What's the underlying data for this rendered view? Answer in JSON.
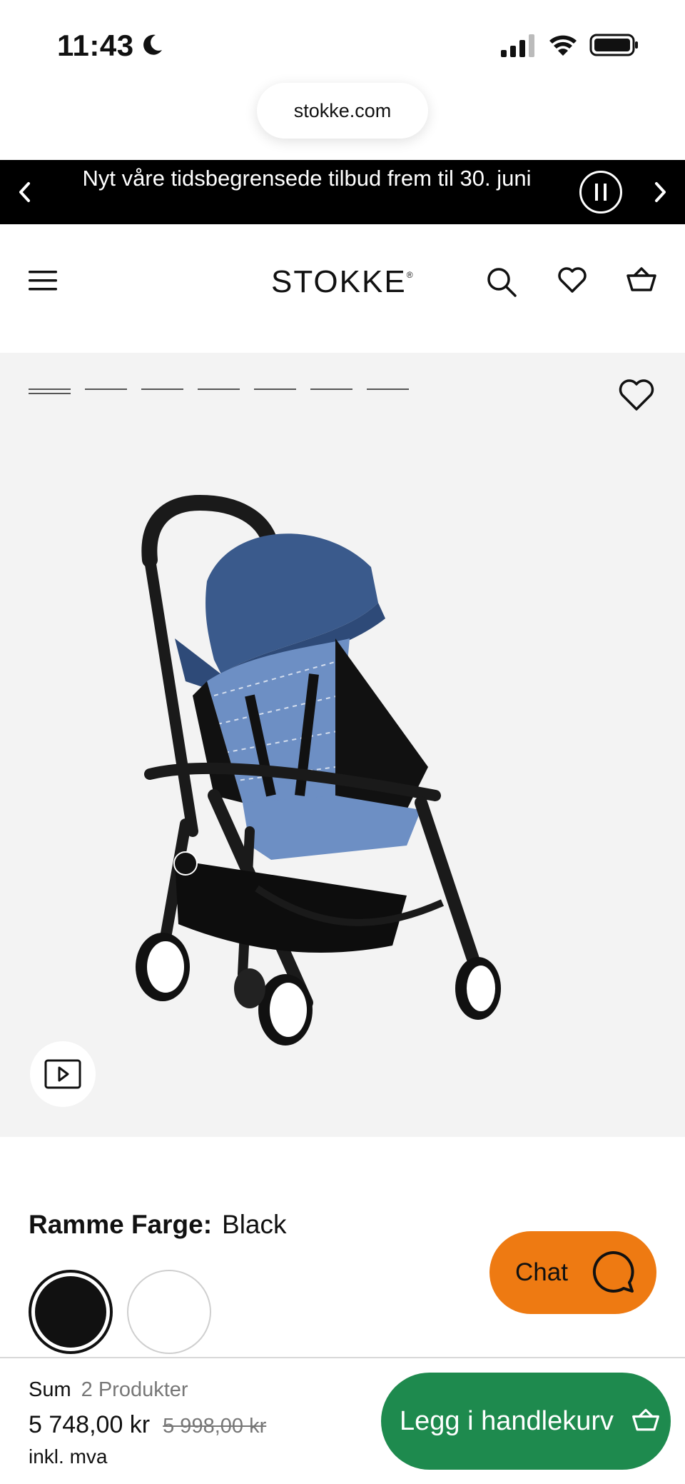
{
  "status_bar": {
    "time": "11:43",
    "icons": [
      "moon-icon",
      "signal-icon",
      "wifi-icon",
      "battery-icon"
    ]
  },
  "browser": {
    "url": "stokke.com"
  },
  "promo": {
    "text": "Nyt våre tidsbegrensede tilbud frem til 30. juni",
    "prev_icon": "chevron-left-icon",
    "next_icon": "chevron-right-icon",
    "pause_icon": "pause-icon"
  },
  "header": {
    "logo": "STOKKE",
    "logo_mark": "®",
    "icons": [
      "menu-icon",
      "search-icon",
      "heart-icon",
      "basket-icon"
    ]
  },
  "gallery": {
    "image_count": 7,
    "active_index": 0,
    "image_alt": "YOYO stroller with blue canopy on black frame",
    "video_icon": "play-icon"
  },
  "product": {
    "color_label": "Ramme Farge:",
    "color_value": "Black",
    "colors": {
      "black": "#111111",
      "white": "#ffffff"
    }
  },
  "chat": {
    "label": "Chat",
    "color": "#ee7a12"
  },
  "summary": {
    "sum_label": "Sum",
    "product_count": "2 Produkter",
    "price": "5 748,00 kr",
    "old_price": "5 998,00 kr",
    "vat_note": "inkl. mva",
    "cta": "Legg i handlekurv",
    "cta_color": "#1e8a4e"
  }
}
